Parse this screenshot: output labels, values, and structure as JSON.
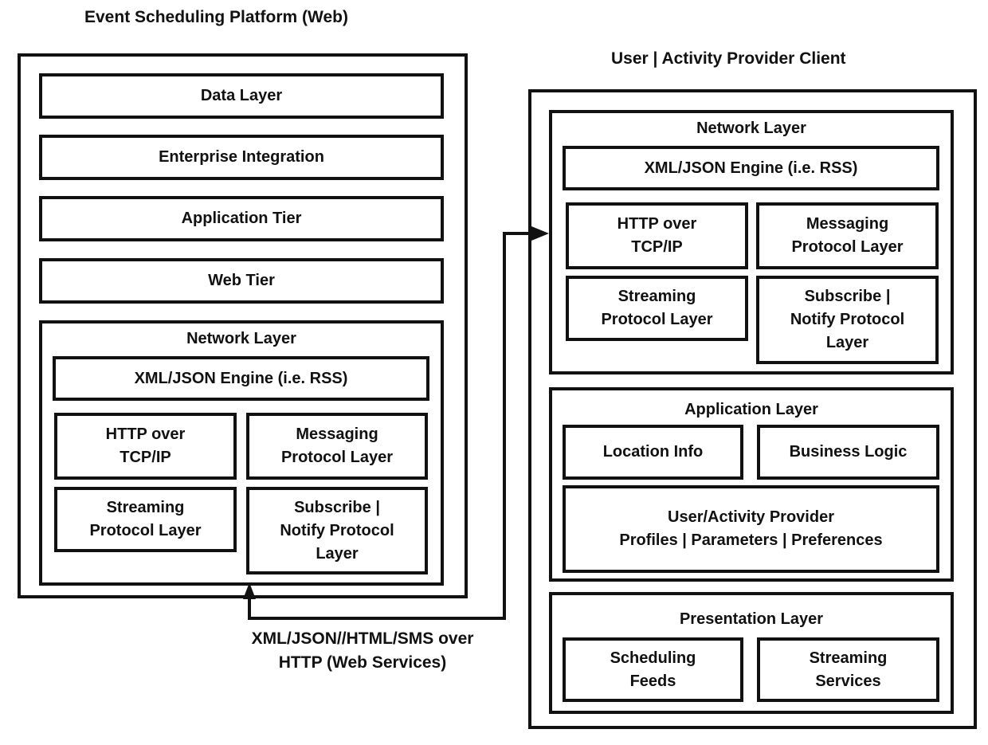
{
  "platform": {
    "title": "Event Scheduling Platform (Web)",
    "tiers": [
      "Data Layer",
      "Enterprise Integration",
      "Application Tier",
      "Web Tier"
    ],
    "network_layer": {
      "label": "Network Layer",
      "engine": "XML/JSON Engine (i.e. RSS)",
      "protocols": [
        "HTTP over\nTCP/IP",
        "Messaging\nProtocol Layer",
        "Streaming\nProtocol Layer",
        "Subscribe |\nNotify Protocol\nLayer"
      ]
    }
  },
  "client": {
    "title": "User | Activity Provider Client",
    "network_layer": {
      "label": "Network Layer",
      "engine": "XML/JSON Engine (i.e. RSS)",
      "protocols": [
        "HTTP over\nTCP/IP",
        "Messaging\nProtocol Layer",
        "Streaming\nProtocol Layer",
        "Subscribe |\nNotify Protocol\nLayer"
      ]
    },
    "application_layer": {
      "label": "Application Layer",
      "items": [
        "Location Info",
        "Business Logic",
        "User/Activity Provider\nProfiles | Parameters | Preferences"
      ]
    },
    "presentation_layer": {
      "label": "Presentation Layer",
      "items": [
        "Scheduling\nFeeds",
        "Streaming\nServices"
      ]
    }
  },
  "connection": {
    "label": "XML/JSON//HTML/SMS over\nHTTP  (Web Services)"
  }
}
